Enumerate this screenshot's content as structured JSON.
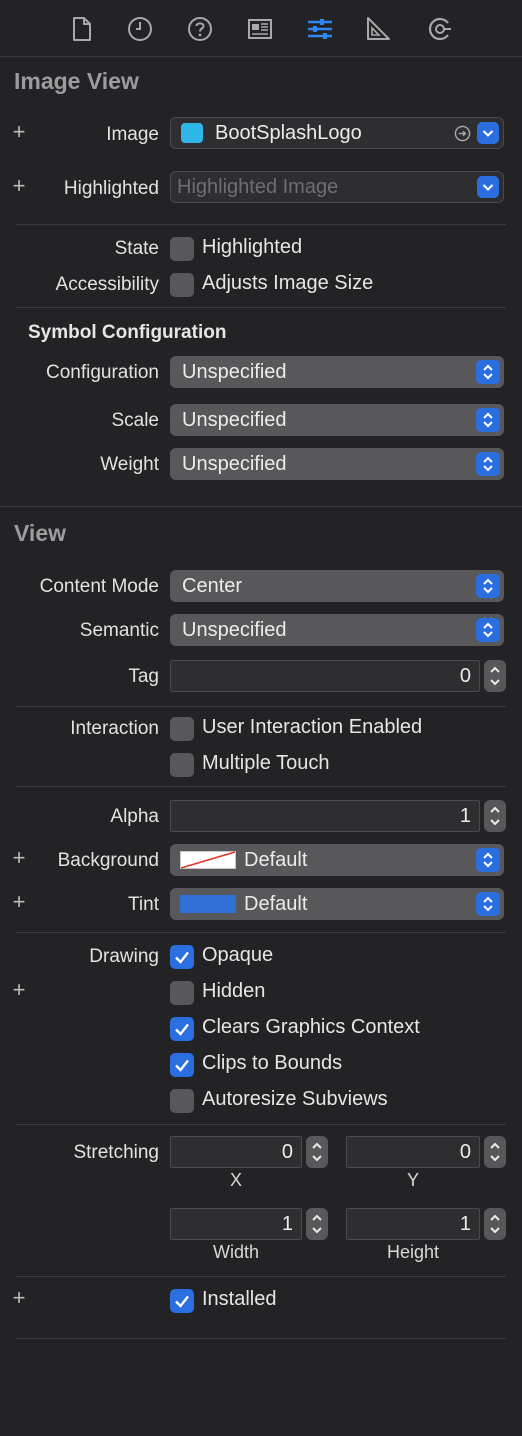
{
  "section_image_view": {
    "title": "Image View",
    "image_label": "Image",
    "image_value": "BootSplashLogo",
    "highlighted_label": "Highlighted",
    "highlighted_placeholder": "Highlighted Image",
    "state_label": "State",
    "state_option": "Highlighted",
    "accessibility_label": "Accessibility",
    "accessibility_option": "Adjusts Image Size"
  },
  "symbol_configuration": {
    "title": "Symbol Configuration",
    "configuration_label": "Configuration",
    "configuration_value": "Unspecified",
    "scale_label": "Scale",
    "scale_value": "Unspecified",
    "weight_label": "Weight",
    "weight_value": "Unspecified"
  },
  "section_view": {
    "title": "View",
    "content_mode_label": "Content Mode",
    "content_mode_value": "Center",
    "semantic_label": "Semantic",
    "semantic_value": "Unspecified",
    "tag_label": "Tag",
    "tag_value": "0",
    "interaction_label": "Interaction",
    "interaction_options": [
      {
        "label": "User Interaction Enabled",
        "checked": false
      },
      {
        "label": "Multiple Touch",
        "checked": false
      }
    ],
    "alpha_label": "Alpha",
    "alpha_value": "1",
    "background_label": "Background",
    "background_value": "Default",
    "tint_label": "Tint",
    "tint_value": "Default",
    "tint_color": "#2f6fd6",
    "drawing_label": "Drawing",
    "drawing_options": [
      {
        "label": "Opaque",
        "checked": true
      },
      {
        "label": "Hidden",
        "checked": false
      },
      {
        "label": "Clears Graphics Context",
        "checked": true
      },
      {
        "label": "Clips to Bounds",
        "checked": true
      },
      {
        "label": "Autoresize Subviews",
        "checked": false
      }
    ],
    "stretching_label": "Stretching",
    "stretch_x": "0",
    "stretch_y": "0",
    "stretch_width": "1",
    "stretch_height": "1",
    "x_caption": "X",
    "y_caption": "Y",
    "width_caption": "Width",
    "height_caption": "Height",
    "installed_label": "Installed",
    "installed_checked": true
  },
  "colors": {
    "accent": "#2a6ee0",
    "panel_bg": "#232224",
    "active_tab": "#2f86f5"
  },
  "tabs": [
    {
      "icon": "file-icon"
    },
    {
      "icon": "history-icon"
    },
    {
      "icon": "help-icon"
    },
    {
      "icon": "identity-icon"
    },
    {
      "icon": "attributes-icon"
    },
    {
      "icon": "size-icon"
    },
    {
      "icon": "connections-icon"
    }
  ]
}
